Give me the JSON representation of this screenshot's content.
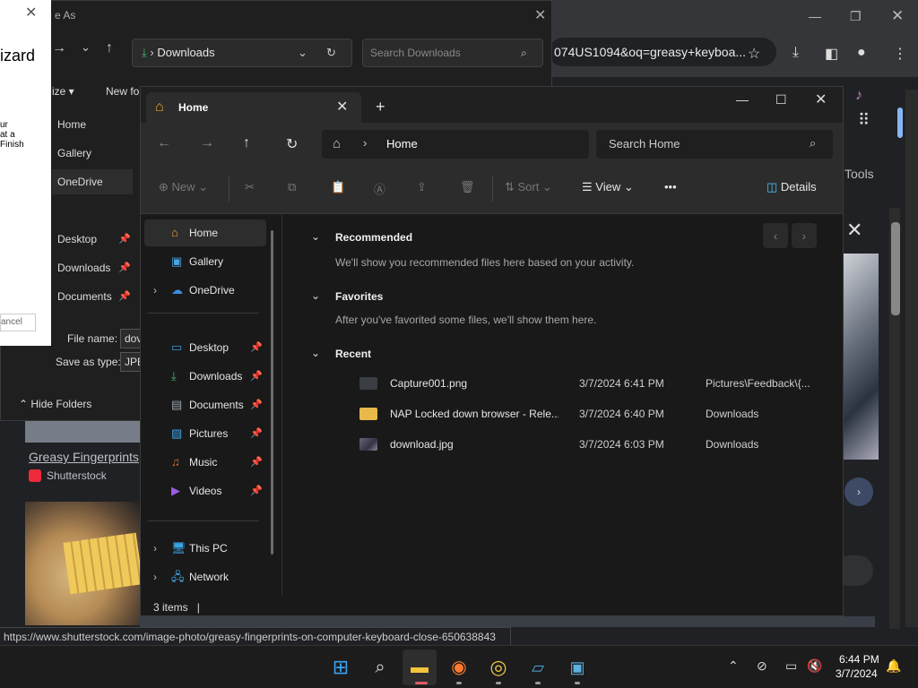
{
  "browser": {
    "omnibox_text": "074US1094&oq=greasy+keyboa...",
    "tools_label": "Tools",
    "result_title": "Greasy Fingerprints",
    "result_source": "Shutterstock",
    "status_url": "https://www.shutterstock.com/image-photo/greasy-fingerprints-on-computer-keyboard-close-650638843"
  },
  "wizard": {
    "title": "izard",
    "text_lines": [
      "ur",
      "at a",
      "Finish"
    ],
    "cancel_label": "ancel"
  },
  "save_as": {
    "title": "e As",
    "address_folder": "Downloads",
    "search_placeholder": "Search Downloads",
    "organize_label": "ize",
    "new_folder_label": "New fol",
    "sidebar": [
      {
        "label": "Home"
      },
      {
        "label": "Gallery"
      },
      {
        "label": "OneDrive"
      },
      {
        "label": "Desktop"
      },
      {
        "label": "Downloads"
      },
      {
        "label": "Documents"
      }
    ],
    "file_name_label": "File name:",
    "file_name_value": "dov",
    "save_as_type_label": "Save as type:",
    "save_as_type_value": "JPEG",
    "hide_folders_label": "Hide Folders"
  },
  "explorer": {
    "tab_title": "Home",
    "address": "Home",
    "search_placeholder": "Search Home",
    "commands": {
      "new": "New",
      "sort": "Sort",
      "view": "View",
      "more": "•••",
      "details": "Details"
    },
    "nav": {
      "home": "Home",
      "gallery": "Gallery",
      "onedrive": "OneDrive",
      "desktop": "Desktop",
      "downloads": "Downloads",
      "documents": "Documents",
      "pictures": "Pictures",
      "music": "Music",
      "videos": "Videos",
      "this_pc": "This PC",
      "network": "Network"
    },
    "sections": {
      "recommended": {
        "title": "Recommended",
        "desc": "We'll show you recommended files here based on your activity."
      },
      "favorites": {
        "title": "Favorites",
        "desc": "After you've favorited some files, we'll show them here."
      },
      "recent": {
        "title": "Recent"
      }
    },
    "recent_files": [
      {
        "name": "Capture001.png",
        "date": "3/7/2024 6:41 PM",
        "location": "Pictures\\Feedback\\{..."
      },
      {
        "name": "NAP Locked down browser - Rele...",
        "date": "3/7/2024 6:40 PM",
        "location": "Downloads"
      },
      {
        "name": "download.jpg",
        "date": "3/7/2024 6:03 PM",
        "location": "Downloads"
      }
    ],
    "status": "3 items"
  },
  "taskbar": {
    "time": "6:44 PM",
    "date": "3/7/2024"
  },
  "colors": {
    "accent": "#4cc2ff",
    "folder": "#f0c040",
    "pin": "#aaaaaa"
  }
}
